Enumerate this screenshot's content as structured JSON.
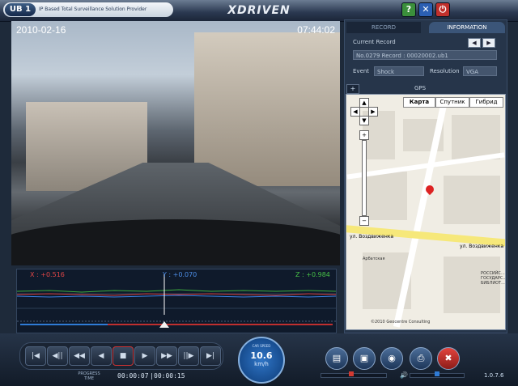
{
  "header": {
    "logo_ub": "UB 1",
    "logo_tagline": "IP Based Total Surveillance Solution Provider",
    "brand": "XDRIVEN",
    "help_label": "?",
    "minimize_label": "✕",
    "power_label": "⏻"
  },
  "video": {
    "date": "2010-02-16",
    "time": "07:44:02"
  },
  "graph": {
    "x_label": "X : +0.516",
    "y_label": "Y : +0.070",
    "z_label": "Z : +0.984"
  },
  "panel": {
    "tab_record": "RECORD",
    "tab_information": "INFORMATION",
    "current_record_label": "Current Record",
    "record_value": "No.0279 Record : 00020002.ub1",
    "event_label": "Event",
    "event_value": "Shock",
    "resolution_label": "Resolution",
    "resolution_value": "VGA",
    "gps_label": "GPS",
    "gps_plus": "+"
  },
  "map": {
    "btn_map": "Карта",
    "btn_satellite": "Спутник",
    "btn_hybrid": "Гибрид",
    "street_main": "ул. Воздвиженка",
    "street_main_2": "ул. Воздвиженка",
    "place_1": "Арбатская",
    "place_2": "РОССИЙС... ГОСУДАРС... БИБЛИОТ...",
    "copyright": "©2010 Geocentre Consulting"
  },
  "bottom": {
    "buttons": [
      "|◀",
      "◀||",
      "◀◀",
      "◀",
      "■",
      "▶",
      "▶▶",
      "||▶",
      "▶|"
    ],
    "progress_label": "PROGRESS TIME",
    "elapsed": "00:00:07",
    "total": "00:00:15",
    "speed_caption": "CAR SPEED",
    "speed_value": "10.6",
    "speed_unit": "km/h",
    "version": "1.0.7.6"
  }
}
